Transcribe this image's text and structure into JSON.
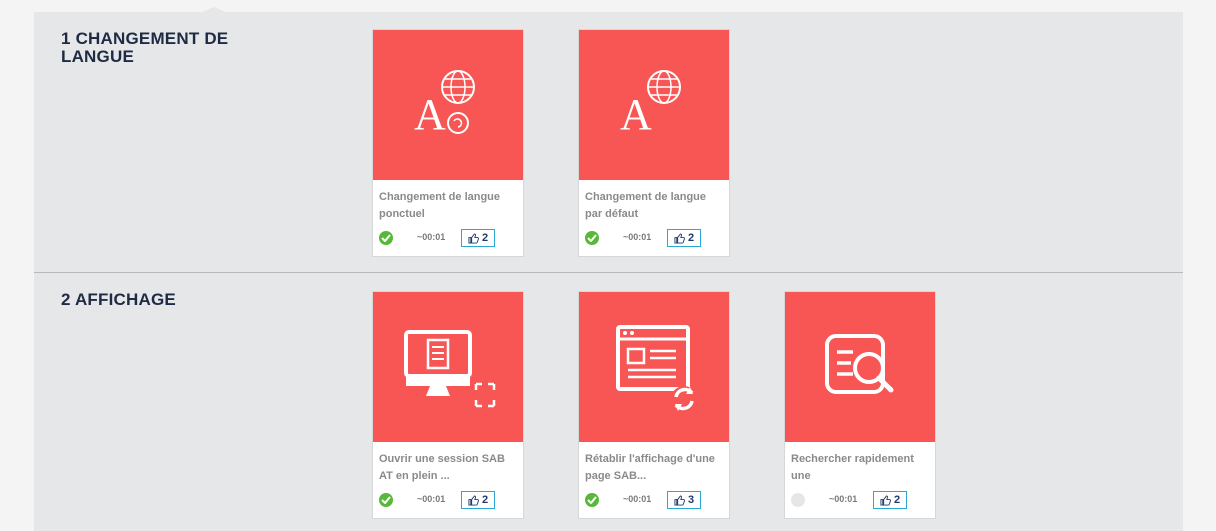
{
  "sections": [
    {
      "title": "1 CHANGEMENT DE LANGUE",
      "cards": [
        {
          "title": "Changement de langue ponctuel",
          "icon": "language-change-icon",
          "status": "completed",
          "duration": "~00:01",
          "likes": "2"
        },
        {
          "title": "Changement de langue par défaut",
          "icon": "language-default-icon",
          "status": "completed",
          "duration": "~00:01",
          "likes": "2"
        }
      ]
    },
    {
      "title": "2 AFFICHAGE",
      "cards": [
        {
          "title": "Ouvrir une session SAB AT en plein ...",
          "icon": "fullscreen-monitor-icon",
          "status": "completed",
          "duration": "~00:01",
          "likes": "2"
        },
        {
          "title": "Rétablir l'affichage d'une page SAB...",
          "icon": "refresh-page-icon",
          "status": "completed",
          "duration": "~00:01",
          "likes": "3"
        },
        {
          "title": "Rechercher rapidement une",
          "icon": "search-document-icon",
          "status": "not-started",
          "duration": "~00:01",
          "likes": "2"
        }
      ]
    }
  ],
  "colors": {
    "thumb": "#f75655",
    "completed": "#57b83a",
    "like_border": "#29a8d8",
    "title": "#1f2a44"
  }
}
